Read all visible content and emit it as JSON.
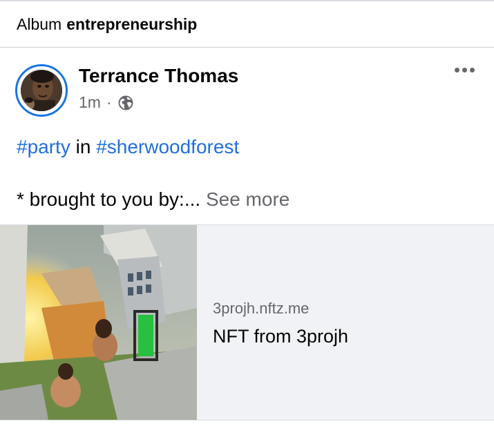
{
  "album": {
    "prefix": "Album",
    "name": "entrepreneurship"
  },
  "post": {
    "author": "Terrance Thomas",
    "time": "1m",
    "separator": "·",
    "privacy_icon": "globe-icon",
    "more_icon": "more-options-icon",
    "text": {
      "tag1": "#party",
      "connector": " in ",
      "tag2": "#sherwoodforest",
      "line2": "* brought to you by:...",
      "see_more": "See more"
    },
    "link": {
      "domain": "3projh.nftz.me",
      "title": "NFT from 3projh"
    }
  },
  "colors": {
    "accent": "#1b74e4",
    "hashtag": "#216fdb",
    "secondary_text": "#65676b",
    "card_bg": "#f0f2f5"
  }
}
